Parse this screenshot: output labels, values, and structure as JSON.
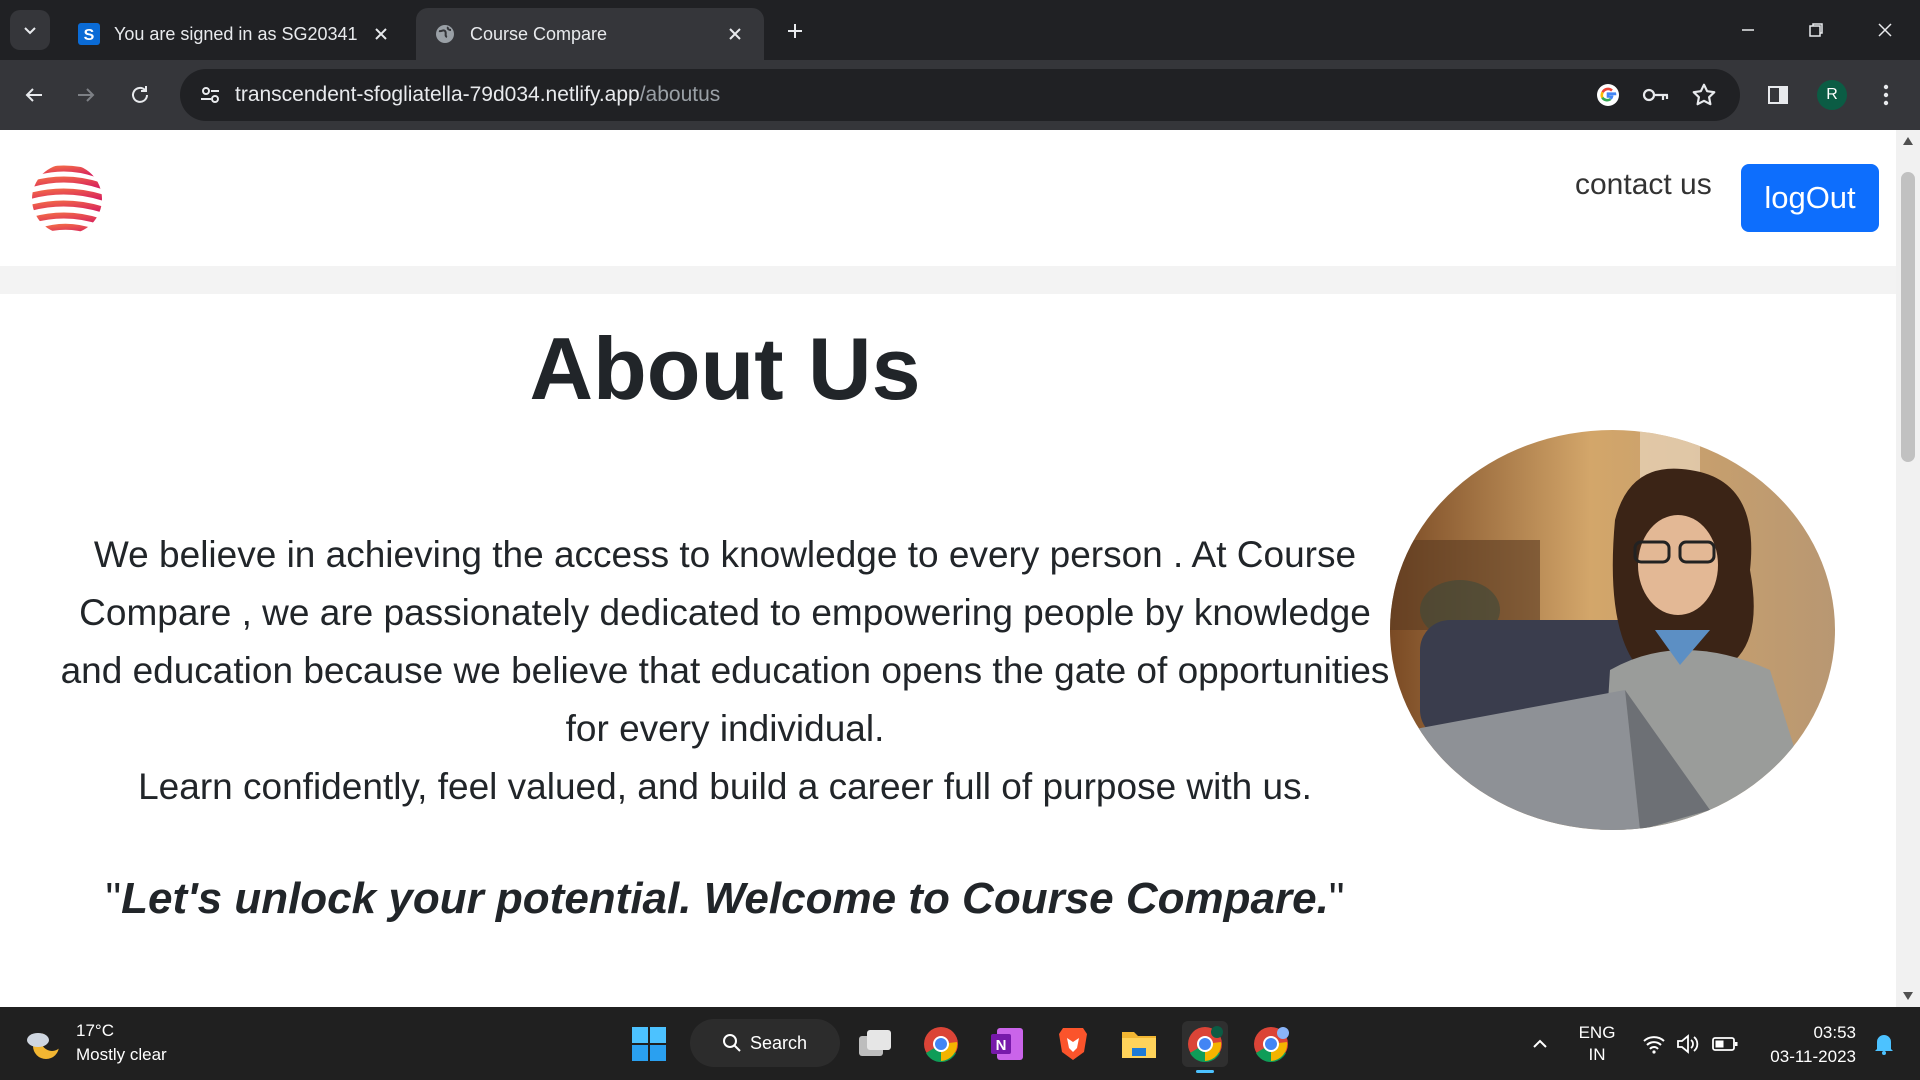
{
  "browser": {
    "tabs": [
      {
        "title": "You are signed in as SG20341",
        "favicon": "s-letter-icon",
        "active": false
      },
      {
        "title": "Course Compare",
        "favicon": "globe-icon",
        "active": true
      }
    ],
    "url_domain": "transcendent-sfogliatella-79d034.netlify.app",
    "url_path": "/aboutus",
    "profile_initial": "R"
  },
  "site": {
    "nav": {
      "contact_label": "contact us",
      "logout_label": "logOut"
    },
    "about": {
      "title": "About Us",
      "paragraph_1": "We believe in achieving the access to knowledge to every person . At Course Compare , we are passionately dedicated to empowering people by knowledge and education because we believe that education opens the gate of opportunities for every individual.",
      "paragraph_2": "Learn confidently, feel valued, and build a career full of purpose with us.",
      "quote_open": "\"",
      "quote_text": "Let's unlock your potential. Welcome to Course Compare.",
      "quote_close": "\""
    }
  },
  "taskbar": {
    "weather_temp": "17°C",
    "weather_desc": "Mostly clear",
    "search_label": "Search",
    "lang_line_1": "ENG",
    "lang_line_2": "IN",
    "time": "03:53",
    "date": "03-11-2023"
  },
  "colors": {
    "primary_button": "#0d6efd",
    "chrome_dark": "#202124",
    "chrome_toolbar": "#35363a",
    "taskbar": "#202020"
  }
}
